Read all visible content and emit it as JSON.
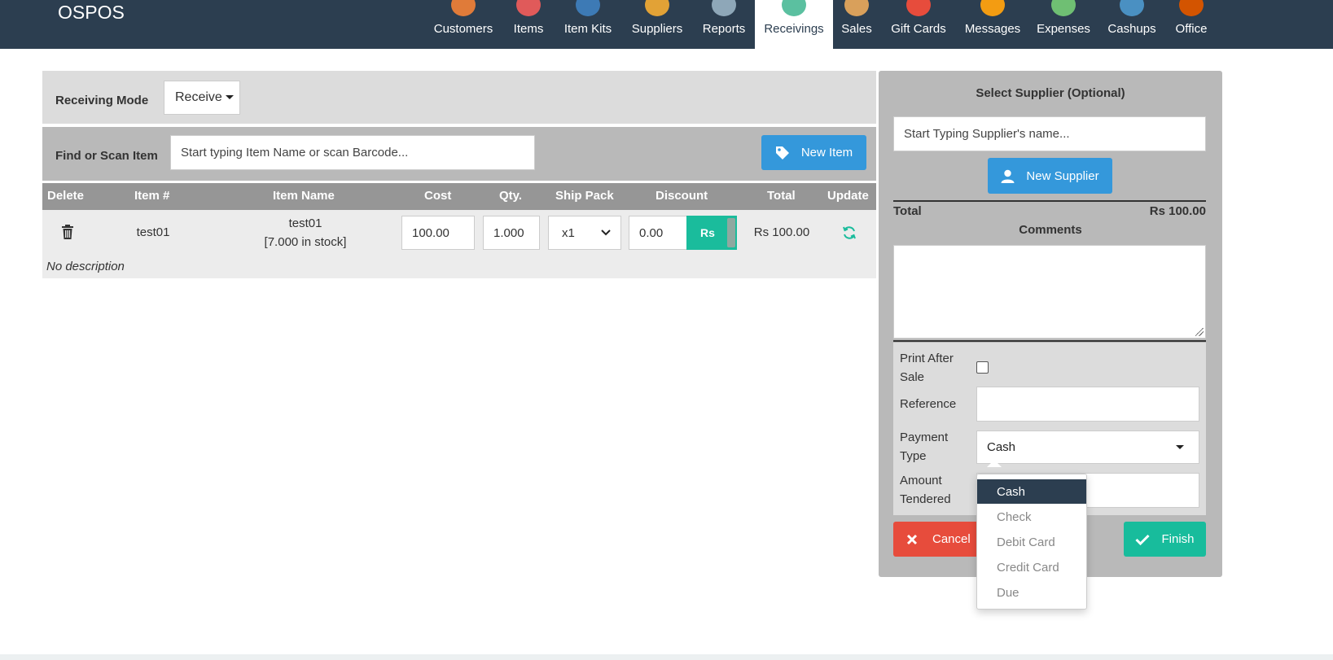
{
  "app": {
    "brand": "OSPOS"
  },
  "nav": {
    "items": [
      {
        "label": "Customers",
        "icon": "customers-icon",
        "color": "#e07b39"
      },
      {
        "label": "Items",
        "icon": "items-icon",
        "color": "#e05a5a"
      },
      {
        "label": "Item Kits",
        "icon": "item-kits-icon",
        "color": "#3d7ab5"
      },
      {
        "label": "Suppliers",
        "icon": "suppliers-icon",
        "color": "#e2a236"
      },
      {
        "label": "Reports",
        "icon": "reports-icon",
        "color": "#8ea7b8"
      },
      {
        "label": "Receivings",
        "icon": "receivings-icon",
        "color": "#5bc0a0",
        "active": true
      },
      {
        "label": "Sales",
        "icon": "sales-icon",
        "color": "#d9a05b"
      },
      {
        "label": "Gift Cards",
        "icon": "gift-cards-icon",
        "color": "#e74c3c"
      },
      {
        "label": "Messages",
        "icon": "messages-icon",
        "color": "#f39c12"
      },
      {
        "label": "Expenses",
        "icon": "expenses-icon",
        "color": "#6fbf73"
      },
      {
        "label": "Cashups",
        "icon": "cashups-icon",
        "color": "#4a90c2"
      },
      {
        "label": "Office",
        "icon": "office-icon",
        "color": "#d35400"
      }
    ]
  },
  "receiving_mode": {
    "label": "Receiving Mode",
    "value": "Receive"
  },
  "scan": {
    "label": "Find or Scan Item",
    "placeholder": "Start typing Item Name or scan Barcode...",
    "new_item_label": "New Item"
  },
  "table": {
    "headers": {
      "delete": "Delete",
      "item_num": "Item #",
      "item_name": "Item Name",
      "cost": "Cost",
      "qty": "Qty.",
      "ship_pack": "Ship Pack",
      "discount": "Discount",
      "total": "Total",
      "update": "Update"
    },
    "rows": [
      {
        "item_num": "test01",
        "item_name": "test01",
        "stock": "[7.000 in stock]",
        "cost": "100.00",
        "qty": "1.000",
        "ship_pack": "x1",
        "discount": "0.00",
        "discount_toggle": "Rs",
        "total": "Rs 100.00",
        "description": "No description"
      }
    ]
  },
  "supplier": {
    "title": "Select Supplier (Optional)",
    "placeholder": "Start Typing Supplier's name...",
    "new_supplier_label": "New Supplier"
  },
  "summary": {
    "total_label": "Total",
    "total_value": "Rs 100.00",
    "comments_label": "Comments"
  },
  "form": {
    "print_after_sale_line1": "Print After",
    "print_after_sale_line2": "Sale",
    "reference_label": "Reference",
    "payment_type_line1": "Payment",
    "payment_type_line2": "Type",
    "payment_type_value": "Cash",
    "amount_tendered_line1": "Amount",
    "amount_tendered_line2": "Tendered"
  },
  "payment_options": [
    "Cash",
    "Check",
    "Debit Card",
    "Credit Card",
    "Due"
  ],
  "actions": {
    "cancel_label": "Cancel",
    "finish_label": "Finish"
  }
}
